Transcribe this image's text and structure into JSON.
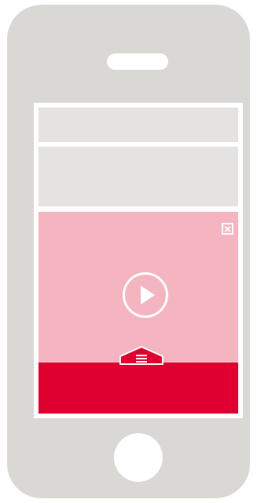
{
  "device": {
    "body_color": "#dad8d5",
    "screen_background": "#ffffff"
  },
  "content_blocks": [
    {
      "color": "#e4e3e1"
    },
    {
      "color": "#e4e3e1"
    }
  ],
  "ad": {
    "background": "#f4b5c1",
    "bar_color": "#e0002f",
    "icons": {
      "close": "close-icon",
      "play": "play-icon",
      "expand": "menu-expand-tab-icon"
    }
  }
}
